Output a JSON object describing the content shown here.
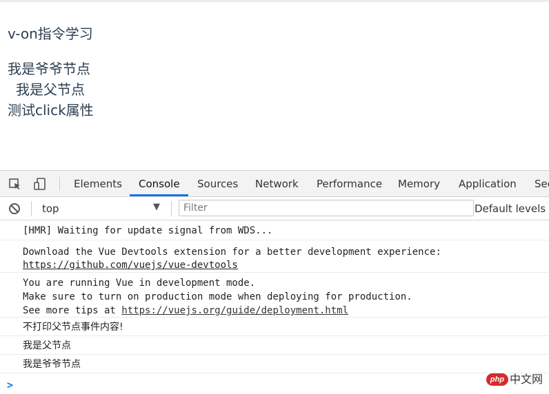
{
  "page": {
    "title": "v-on指令学习",
    "grandparent_text": "我是爷爷节点",
    "parent_text": "我是父节点",
    "child_text": "测试click属性"
  },
  "devtools": {
    "tabs": [
      "Elements",
      "Console",
      "Sources",
      "Network",
      "Performance",
      "Memory",
      "Application",
      "Sec"
    ],
    "active_tab": "Console",
    "accent_color": "#1a73e8",
    "context": "top",
    "filter_placeholder": "Filter",
    "levels": "Default levels ▼",
    "icons": [
      "inspect-icon",
      "device-toggle-icon",
      "clear-console-icon",
      "dropdown-arrow-icon",
      "prompt-chevron-icon"
    ]
  },
  "console": {
    "m1": "[HMR] Waiting for update signal from WDS...",
    "m2_line1": "Download the Vue Devtools extension for a better development experience:",
    "m2_link": "https://github.com/vuejs/vue-devtools",
    "m3_line1": "You are running Vue in development mode.",
    "m3_line2": "Make sure to turn on production mode when deploying for production.",
    "m3_line3_prefix": "See more tips at ",
    "m3_link": "https://vuejs.org/guide/deployment.html",
    "m4": "不打印父节点事件内容!",
    "m5": "我是父节点",
    "m6": "我是爷爷节点",
    "prompt": ">"
  },
  "watermark": {
    "logo_text": "php",
    "site_text": "中文网"
  }
}
